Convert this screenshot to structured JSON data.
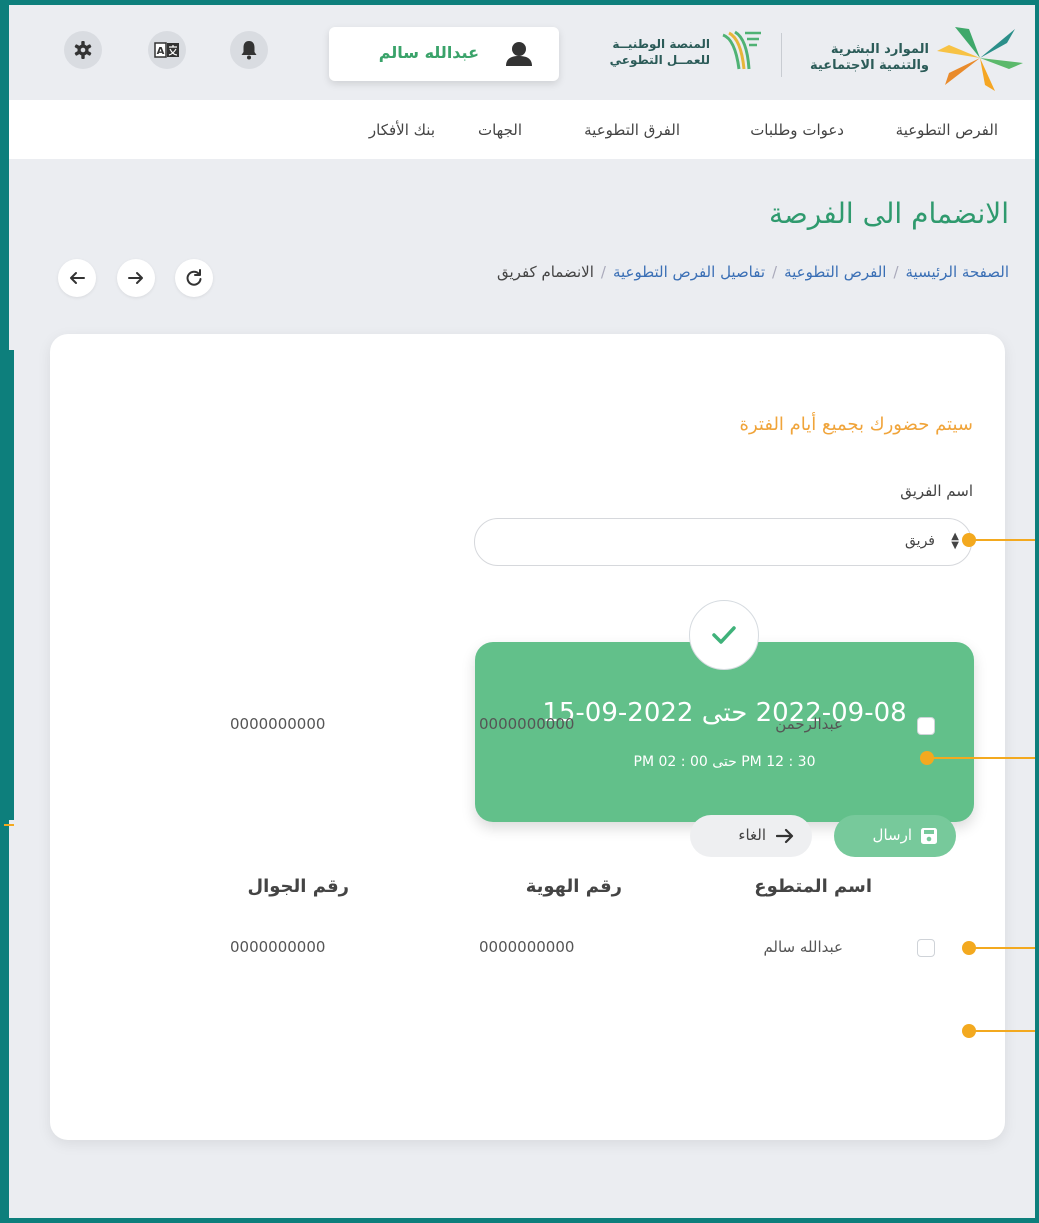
{
  "header": {
    "user_name": "عبدالله سالم",
    "logo_hrsd_line1": "الموارد البشرية",
    "logo_hrsd_line2": "والتنمية الاجتماعية",
    "logo_nvw_line1": "المنصة الوطنيــة",
    "logo_nvw_line2": "للعمــل التطوعي",
    "lang_icon_text": "A"
  },
  "nav": {
    "items": [
      "الفرص التطوعية",
      "دعوات وطلبات",
      "الفرق التطوعية",
      "الجهات",
      "بنك الأفكار"
    ]
  },
  "page": {
    "title": "الانضمام الى الفرصة",
    "breadcrumb": [
      "الصفحة الرئيسية",
      "الفرص التطوعية",
      "تفاصيل الفرص التطوعية",
      "الانضمام كفريق"
    ]
  },
  "form": {
    "notice": "سيتم حضورك بجميع أيام الفترة",
    "team_label": "اسم الفريق",
    "team_selected": "فريق"
  },
  "period": {
    "dates": "2022-09-08   حتى  2022-09-15",
    "times": "30 : 12 PM  حتى  00 : 02 PM"
  },
  "table": {
    "headers": [
      "اسم المتطوع",
      "رقم الهوية",
      "رقم الجوال"
    ],
    "rows": [
      {
        "name": "عبدالله سالم",
        "id": "0000000000",
        "mobile": "0000000000"
      },
      {
        "name": "عبدالرحمن",
        "id": "0000000000",
        "mobile": "0000000000"
      }
    ]
  },
  "actions": {
    "send_label": "ارسال",
    "cancel_label": "الغاء"
  },
  "colors": {
    "brand_green": "#62c08a",
    "title_green": "#2f9a6e",
    "notice_orange": "#f0a43a",
    "frame_teal": "#0d7f7c",
    "callout_orange": "#f3a91f"
  }
}
